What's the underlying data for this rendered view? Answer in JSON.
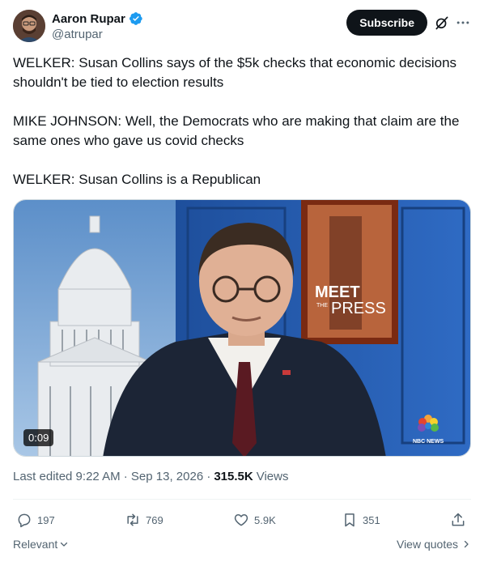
{
  "author": {
    "display_name": "Aaron Rupar",
    "handle": "@atrupar",
    "verified": true
  },
  "header": {
    "subscribe_label": "Subscribe",
    "icons": [
      "grok-icon",
      "more-icon"
    ]
  },
  "tweet": {
    "paragraphs": [
      "WELKER: Susan Collins says of the $5k checks that economic decisions shouldn't be tied to election results",
      "MIKE JOHNSON: Well, the Democrats who are making that claim are the same ones who gave us covid checks",
      "WELKER: Susan Collins is a Republican"
    ]
  },
  "media": {
    "duration": "0:09",
    "logo_text_top": "MEET",
    "logo_text_the": "THE",
    "logo_text_bottom": "PRESS",
    "network_bug": "NBC NEWS"
  },
  "meta": {
    "edited": "Last edited 9:22 AM · Sep 13, 2026 ·",
    "views_count": "315.5K",
    "views_label": "Views"
  },
  "actions": {
    "replies": "197",
    "reposts": "769",
    "likes": "5.9K",
    "bookmarks": "351"
  },
  "footer": {
    "sort_label": "Relevant",
    "view_quotes_label": "View quotes"
  },
  "colors": {
    "primary_text": "#0f1419",
    "secondary_text": "#536471",
    "verified_blue": "#1d9bf0",
    "border": "#eff3f4"
  }
}
